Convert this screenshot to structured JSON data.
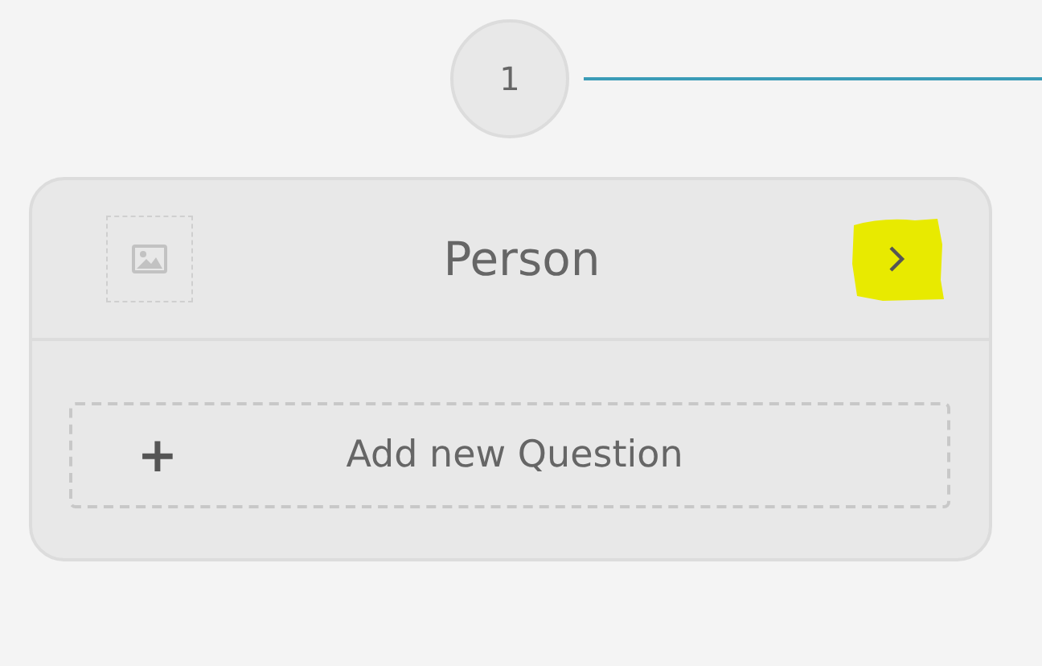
{
  "step": {
    "number": "1"
  },
  "card": {
    "title": "Person",
    "highlighted": true
  },
  "add_question": {
    "icon": "+",
    "label": "Add new Question"
  }
}
